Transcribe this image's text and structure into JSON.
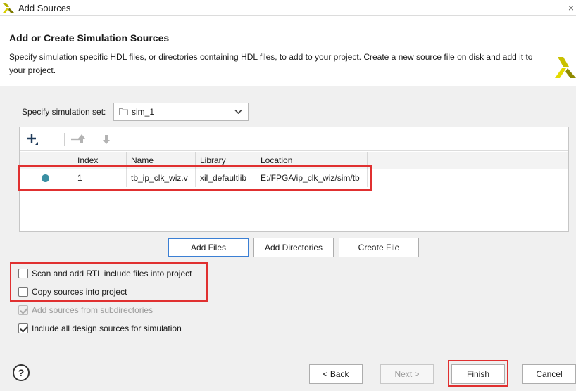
{
  "window": {
    "title": "Add Sources",
    "close_glyph": "×"
  },
  "header": {
    "title": "Add or Create Simulation Sources",
    "description": "Specify simulation specific HDL files, or directories containing HDL files, to add to your project. Create a new source file on disk and add it to your project."
  },
  "simset": {
    "label": "Specify simulation set:",
    "value": "sim_1"
  },
  "table": {
    "columns": [
      "Index",
      "Name",
      "Library",
      "Location"
    ],
    "rows": [
      {
        "index": "1",
        "name": "tb_ip_clk_wiz.v",
        "library": "xil_defaultlib",
        "location": "E:/FPGA/ip_clk_wiz/sim/tb"
      }
    ]
  },
  "buttons": {
    "add_files": "Add Files",
    "add_directories": "Add Directories",
    "create_file": "Create File",
    "back": "< Back",
    "next": "Next >",
    "finish": "Finish",
    "cancel": "Cancel"
  },
  "options": [
    {
      "label": "Scan and add RTL include files into project",
      "checked": false,
      "disabled": false
    },
    {
      "label": "Copy sources into project",
      "checked": false,
      "disabled": false
    },
    {
      "label": "Add sources from subdirectories",
      "checked": true,
      "disabled": true
    },
    {
      "label": "Include all design sources for simulation",
      "checked": true,
      "disabled": false
    }
  ],
  "help": {
    "glyph": "?"
  },
  "colors": {
    "accent": "#3b7fd4",
    "highlight": "#e03030",
    "status_dot": "#3a8fa3",
    "brand": "#c9c100"
  }
}
